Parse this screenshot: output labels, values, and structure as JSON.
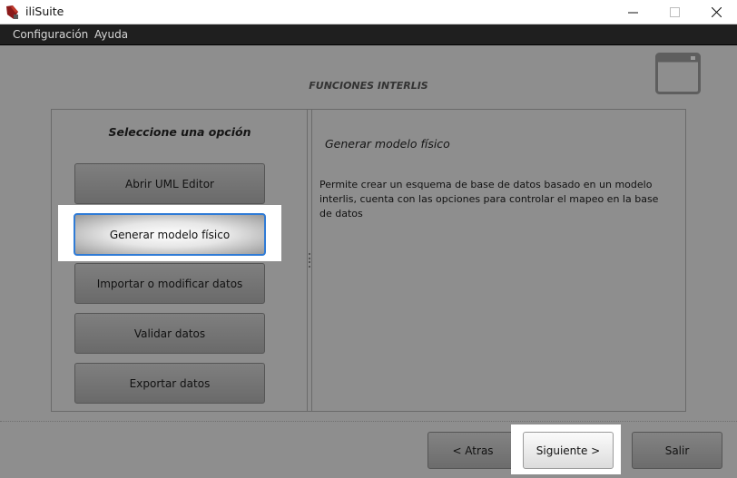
{
  "window": {
    "title": "iliSuite",
    "app_icon": "ilisuite-logo-icon",
    "controls": [
      "minimize-icon",
      "maximize-icon",
      "close-icon"
    ]
  },
  "menu": {
    "items": [
      {
        "label": "Configuración"
      },
      {
        "label": "Ayuda"
      }
    ]
  },
  "main": {
    "section_title": "FUNCIONES INTERLIS",
    "header_icon": "window-frame-icon",
    "options_title": "Seleccione una opción",
    "options": [
      {
        "label": "Abrir UML Editor",
        "selected": false
      },
      {
        "label": "Generar modelo físico",
        "selected": true
      },
      {
        "label": "Importar o modificar datos",
        "selected": false
      },
      {
        "label": "Validar datos",
        "selected": false
      },
      {
        "label": "Exportar datos",
        "selected": false
      }
    ],
    "detail": {
      "title": "Generar modelo físico",
      "description": "Permite crear un esquema de base de datos basado en un modelo interlis, cuenta con las opciones para controlar el mapeo en la base de datos"
    }
  },
  "footer": {
    "back_label": "< Atras",
    "next_label": "Siguiente >",
    "exit_label": "Salir"
  },
  "colors": {
    "selection_border": "#2f7bd6",
    "menubar_bg": "#1f1f1f",
    "content_bg": "#8e8e8e",
    "app_icon_red": "#8b1a1a"
  }
}
